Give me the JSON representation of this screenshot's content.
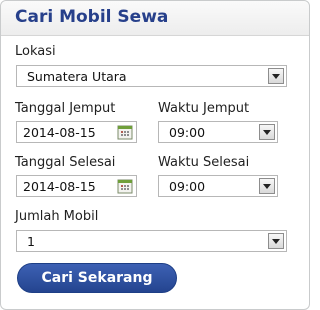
{
  "widget": {
    "title": "Cari Mobil Sewa",
    "location": {
      "label": "Lokasi",
      "value": "Sumatera Utara"
    },
    "pickup_date": {
      "label": "Tanggal Jemput",
      "value": "2014-08-15"
    },
    "pickup_time": {
      "label": "Waktu Jemput",
      "value": "09:00"
    },
    "return_date": {
      "label": "Tanggal Selesai",
      "value": "2014-08-15"
    },
    "return_time": {
      "label": "Waktu Selesai",
      "value": "09:00"
    },
    "car_count": {
      "label": "Jumlah Mobil",
      "value": "1"
    },
    "search_button": "Cari Sekarang"
  },
  "colors": {
    "title": "#27408b",
    "button": "#2c4f9e",
    "calendar_icon": "#6f9f3a"
  },
  "icons": [
    "calendar-icon",
    "dropdown-arrow-icon"
  ]
}
